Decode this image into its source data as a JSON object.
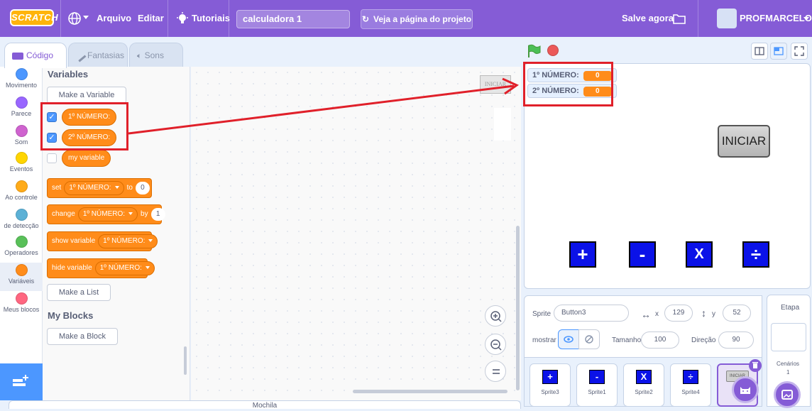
{
  "menubar": {
    "logo": "SCRATCH",
    "file": "Arquivo",
    "edit": "Editar",
    "tutorials": "Tutoriais",
    "project_title": "calculadora 1",
    "see_project": "Veja a página do projeto",
    "save_now": "Salve agora",
    "username": "PROFMARCELOG"
  },
  "tabs": {
    "code": "Código",
    "costumes": "Fantasias",
    "sounds": "Sons"
  },
  "categories": [
    {
      "label": "Movimento",
      "color": "#4c97ff"
    },
    {
      "label": "Parece",
      "color": "#9966ff"
    },
    {
      "label": "Som",
      "color": "#cf63cf"
    },
    {
      "label": "Eventos",
      "color": "#ffd500"
    },
    {
      "label": "Ao controle",
      "color": "#ffab19"
    },
    {
      "label": "de detecção",
      "color": "#5cb1d6"
    },
    {
      "label": "Operadores",
      "color": "#59c059"
    },
    {
      "label": "Variáveis",
      "color": "#ff8c1a"
    },
    {
      "label": "Meus blocos",
      "color": "#ff6680"
    }
  ],
  "palette": {
    "variables_heading": "Variables",
    "make_variable": "Make a Variable",
    "var1": "1º NÚMERO:",
    "var2": "2º NÚMERO:",
    "var3": "my variable",
    "set_kw": "set",
    "set_to": "to",
    "set_value": "0",
    "change_kw": "change",
    "change_by": "by",
    "change_value": "1",
    "show_kw": "show variable",
    "hide_kw": "hide variable",
    "block_var": "1º NÚMERO:",
    "make_list": "Make a List",
    "myblocks_heading": "My Blocks",
    "make_block": "Make a Block"
  },
  "code_area": {
    "sprite_thumb_label": "INICIAR"
  },
  "backpack": {
    "label": "Mochila"
  },
  "stage": {
    "monitor1_label": "1º NÚMERO:",
    "monitor1_value": "0",
    "monitor2_label": "2º NÚMERO:",
    "monitor2_value": "0",
    "start_button": "INICIAR",
    "op_add": "+",
    "op_sub": "-",
    "op_mul": "X",
    "op_div": "÷"
  },
  "sprite_info": {
    "sprite_label": "Sprite",
    "sprite_name": "Button3",
    "x_label": "x",
    "x_value": "129",
    "y_label": "y",
    "y_value": "52",
    "show_label": "mostrar",
    "size_label": "Tamanho",
    "size_value": "100",
    "direction_label": "Direção",
    "direction_value": "90"
  },
  "sprites": [
    {
      "name": "Sprite3",
      "glyph": "+"
    },
    {
      "name": "Sprite1",
      "glyph": "-"
    },
    {
      "name": "Sprite2",
      "glyph": "X"
    },
    {
      "name": "Sprite4",
      "glyph": "÷"
    },
    {
      "name": "",
      "glyph": "INICIAR"
    }
  ],
  "stage_panel": {
    "title": "Etapa",
    "backdrops_label": "Cenários",
    "backdrops_count": "1"
  },
  "colors": {
    "scratch_purple": "#855cd6",
    "variable_orange": "#ff8c1a",
    "highlight_red": "#e0202a",
    "operator_blue": "#0b12e8"
  }
}
